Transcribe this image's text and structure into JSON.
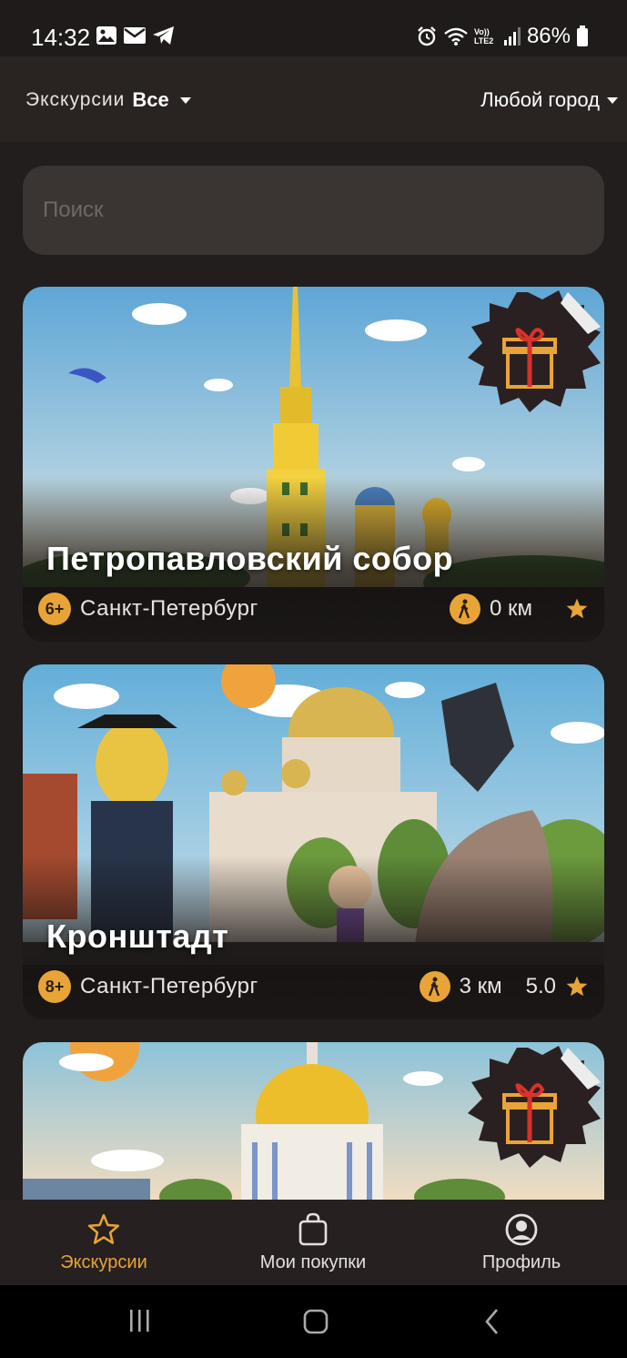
{
  "status_bar": {
    "time": "14:32",
    "battery": "86%",
    "icons": [
      "image-icon",
      "mail-icon",
      "telegram-icon",
      "alarm-icon",
      "wifi-icon",
      "volte-icon",
      "signal-icon",
      "battery-icon"
    ],
    "volte_label": "Vo)) LTE2"
  },
  "header": {
    "tours_label": "Экскурсии",
    "tours_value": "Все",
    "city_value": "Любой город"
  },
  "search": {
    "placeholder": "Поиск"
  },
  "cards": [
    {
      "title": "Петропавловский собор",
      "age": "6+",
      "city": "Санкт-Петербург",
      "distance": "0 км",
      "rating": "",
      "gift": true
    },
    {
      "title": "Кронштадт",
      "age": "8+",
      "city": "Санкт-Петербург",
      "distance": "3 км",
      "rating": "5.0",
      "gift": false
    },
    {
      "title": "",
      "gift": true
    }
  ],
  "bottom_nav": {
    "items": [
      {
        "label": "Экскурсии",
        "icon": "star-icon",
        "active": true
      },
      {
        "label": "Мои покупки",
        "icon": "bag-icon",
        "active": false
      },
      {
        "label": "Профиль",
        "icon": "profile-icon",
        "active": false
      }
    ]
  },
  "colors": {
    "accent": "#e9a437",
    "background": "#211e1d",
    "card": "#1a1716"
  }
}
